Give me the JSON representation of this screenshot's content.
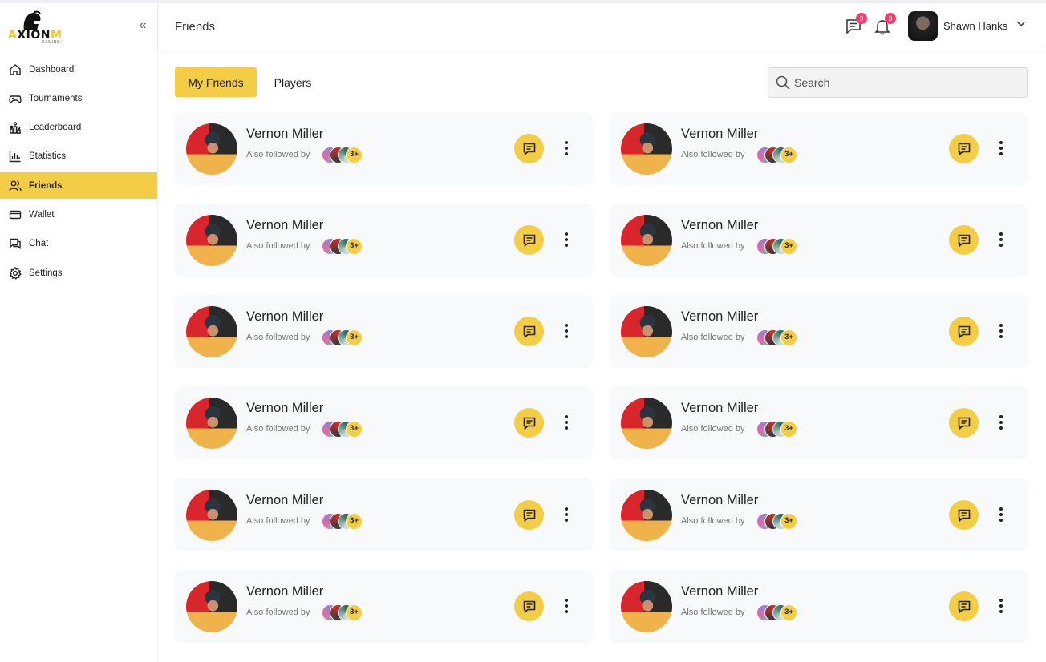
{
  "brand": {
    "logo_text_a": "A",
    "logo_text_rest": "XION",
    "logo_sub": "GAMING"
  },
  "sidebar": {
    "collapse_icon": "double-chevron-left-icon",
    "items": [
      {
        "label": "Dashboard",
        "icon": "home-icon",
        "active": false
      },
      {
        "label": "Tournaments",
        "icon": "gamepad-icon",
        "active": false
      },
      {
        "label": "Leaderboard",
        "icon": "leaderboard-icon",
        "active": false
      },
      {
        "label": "Statistics",
        "icon": "bar-chart-icon",
        "active": false
      },
      {
        "label": "Friends",
        "icon": "users-icon",
        "active": true
      },
      {
        "label": "Wallet",
        "icon": "card-icon",
        "active": false
      },
      {
        "label": "Chat",
        "icon": "chat-icon",
        "active": false
      },
      {
        "label": "Settings",
        "icon": "gear-icon",
        "active": false
      }
    ]
  },
  "header": {
    "title": "Friends",
    "messages_badge": "3",
    "notifications_badge": "3",
    "user_name": "Shawn Hanks"
  },
  "tabs": {
    "my_friends": "My Friends",
    "players": "Players"
  },
  "search": {
    "placeholder": "Search"
  },
  "friends": [
    {
      "name": "Vernon Miller",
      "sub": "Also followed by",
      "more": "3+"
    },
    {
      "name": "Vernon Miller",
      "sub": "Also followed by",
      "more": "3+"
    },
    {
      "name": "Vernon Miller",
      "sub": "Also followed by",
      "more": "3+"
    },
    {
      "name": "Vernon Miller",
      "sub": "Also followed by",
      "more": "3+"
    },
    {
      "name": "Vernon Miller",
      "sub": "Also followed by",
      "more": "3+"
    },
    {
      "name": "Vernon Miller",
      "sub": "Also followed by",
      "more": "3+"
    },
    {
      "name": "Vernon Miller",
      "sub": "Also followed by",
      "more": "3+"
    },
    {
      "name": "Vernon Miller",
      "sub": "Also followed by",
      "more": "3+"
    },
    {
      "name": "Vernon Miller",
      "sub": "Also followed by",
      "more": "3+"
    },
    {
      "name": "Vernon Miller",
      "sub": "Also followed by",
      "more": "3+"
    },
    {
      "name": "Vernon Miller",
      "sub": "Also followed by",
      "more": "3+"
    },
    {
      "name": "Vernon Miller",
      "sub": "Also followed by",
      "more": "3+"
    }
  ],
  "colors": {
    "accent": "#f4cd47",
    "badge": "#ef3f6b",
    "card_bg": "#f8f9fb"
  }
}
